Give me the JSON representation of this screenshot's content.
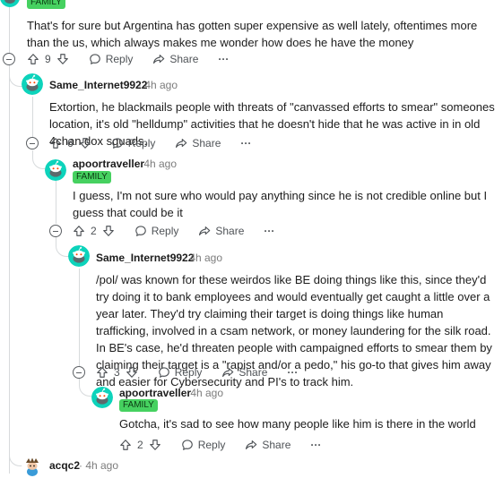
{
  "top_comment": {
    "flair": "FAMILY",
    "text": "That's for sure but Argentina has gotten super expensive as well lately, oftentimes more than the us, which always makes me wonder how does he have the money",
    "votes": "9"
  },
  "actions": {
    "reply": "Reply",
    "share": "Share",
    "more": "···"
  },
  "comments": [
    {
      "username": "Same_Internet9922",
      "time": "· 4h ago",
      "text": "Extortion, he blackmails people with threats of \"canvassed efforts to smear\" someones location, it's old \"helldump\" activities that he doesn't hide that he was active in in old 4chan dox squads.",
      "votes": "6"
    },
    {
      "username": "apoortraveller",
      "time": "· 4h ago",
      "flair": "FAMILY",
      "text": "I guess, I'm not sure who would pay anything since he is not credible online but I guess that could be it",
      "votes": "2"
    },
    {
      "username": "Same_Internet9922",
      "time": "· 4h ago",
      "text": "/pol/ was known for these weirdos like BE doing things like this, since they'd try doing it to bank employees and would eventually get caught a little over a year later. They'd try claiming their target is doing things like human trafficking, involved in a csam network, or money laundering for the silk road. In BE's case, he'd threaten people with campaigned efforts to smear them by claiming their target is a \"rapist and/or a pedo,\" his go-to that gives him away and easier for Cybersecurity and PI's to track him.",
      "votes": "3"
    },
    {
      "username": "apoortraveller",
      "time": "· 4h ago",
      "flair": "FAMILY",
      "text": "Gotcha, it's sad to see how many people like him is there in the world",
      "votes": "2"
    },
    {
      "username": "acqc2",
      "time": "· 4h ago"
    }
  ],
  "colors": {
    "flair": "#46d160",
    "snoo": "#0dd3bb",
    "thread_line": "#d7dadc"
  }
}
